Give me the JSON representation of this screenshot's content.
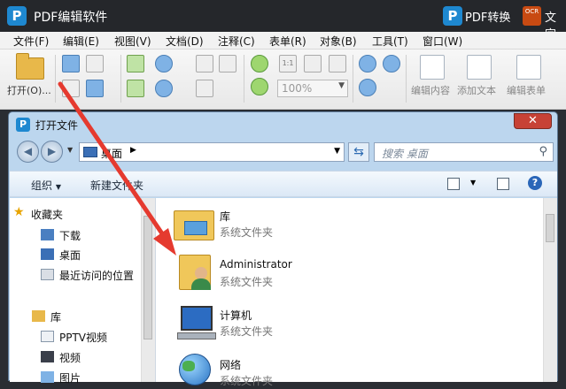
{
  "app": {
    "title": "PDF编辑软件",
    "convert": "PDF转换",
    "ocr_icon_text": "OCR",
    "ocr_label": "文字"
  },
  "menu": [
    "文件(F)",
    "编辑(E)",
    "视图(V)",
    "文档(D)",
    "注释(C)",
    "表单(R)",
    "对象(B)",
    "工具(T)",
    "窗口(W)"
  ],
  "toolbar": {
    "open_label": "打开(O)...",
    "zoom_value": "100%",
    "zoom_actual": "1:1",
    "edit_content_label": "编辑内容",
    "add_text_label": "添加文本",
    "edit_form_label": "编辑表单"
  },
  "dialog": {
    "title": "打开文件",
    "address": "桌面",
    "search_placeholder": "搜索 桌面",
    "organize": "组织",
    "new_folder": "新建文件夹",
    "nav_pane": {
      "favorites": "收藏夹",
      "favorites_items": [
        "下载",
        "桌面",
        "最近访问的位置"
      ],
      "libraries": "库",
      "library_items": [
        "PPTV视频",
        "视频",
        "图片"
      ]
    },
    "files": [
      {
        "name": "库",
        "type": "系统文件夹"
      },
      {
        "name": "Administrator",
        "type": "系统文件夹"
      },
      {
        "name": "计算机",
        "type": "系统文件夹"
      },
      {
        "name": "网络",
        "type": "系统文件夹"
      }
    ]
  },
  "colors": {
    "accent_blue": "#1e88d0",
    "titlebar": "#25272b",
    "arrow_red": "#e53a2f"
  }
}
